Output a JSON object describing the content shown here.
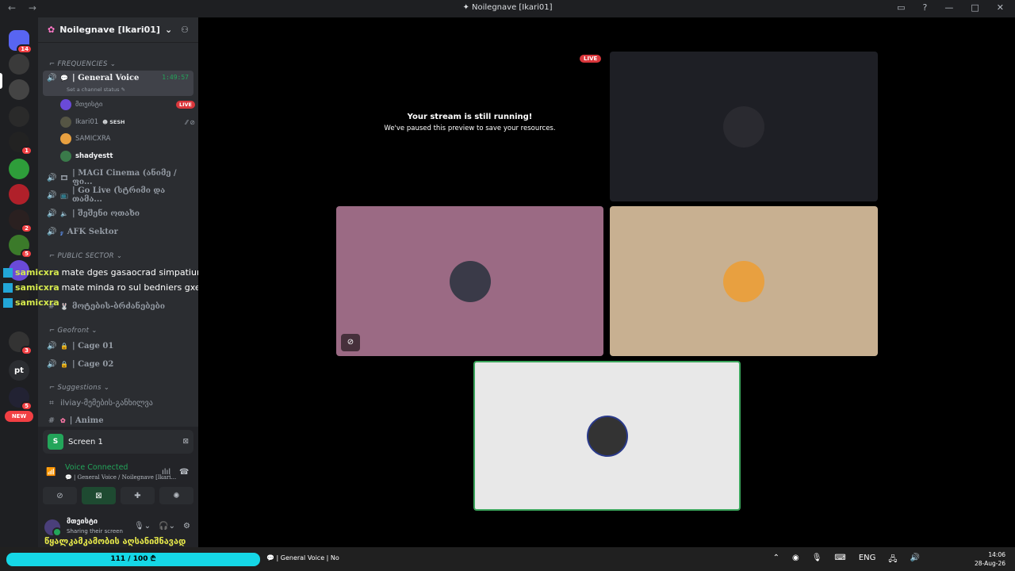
{
  "window": {
    "title": "Noilegnave [Ikari01]",
    "nav": "← →"
  },
  "guilds": {
    "items": [
      {
        "label": "",
        "badge": "14",
        "color": "#5865f2"
      },
      {
        "label": "",
        "badge": "",
        "color": "#3a3a3a"
      },
      {
        "label": "",
        "badge": "",
        "color": "#444"
      },
      {
        "label": "",
        "badge": "",
        "color": "#2a2a2a"
      },
      {
        "label": "",
        "badge": "1",
        "color": "#222"
      },
      {
        "label": "",
        "badge": "",
        "color": "#2e9d3a"
      },
      {
        "label": "",
        "badge": "",
        "color": "#b0202a"
      },
      {
        "label": "",
        "badge": "2",
        "color": "#2a2020"
      },
      {
        "label": "",
        "badge": "5",
        "color": "#3b7a2a"
      },
      {
        "label": "",
        "badge": "",
        "color": "#6a4ad8"
      },
      {
        "label": "",
        "badge": "",
        "color": "#222"
      },
      {
        "label": "",
        "badge": "3",
        "color": "#333"
      },
      {
        "label": "pt",
        "badge": "",
        "color": "#2b2d31"
      },
      {
        "label": "",
        "badge": "5",
        "color": "#223"
      }
    ],
    "new_pill": "NEW"
  },
  "server": {
    "name": "Noilegnave [Ikari01]"
  },
  "categories": {
    "frequencies": "FREQUENCIES",
    "public_sector": "PUBLIC SECTOR",
    "geofront": "Geofront",
    "suggestions": "Suggestions"
  },
  "channels": {
    "general_voice": {
      "name": "| General Voice",
      "timer": "1:49:57",
      "status": "Set a channel status"
    },
    "magi_cinema": "| MAGI Cinema (ანიმე / ფი...",
    "go_live": "| Go Live (სტრიმი და თამა...",
    "shemtsveni": "| შეშენი ოთახი",
    "afk": "AFK Sektor",
    "motebis": "მოტების-ბრძანებები",
    "cage01": "| Cage 01",
    "cage02": "| Cage 02",
    "ilviay": "ilviay-მემების-განხილვა",
    "anime": "| Anime"
  },
  "voice_users": [
    {
      "name": "მთეისტი",
      "badge": "LIVE",
      "color": "#6a4ad8"
    },
    {
      "name": "Ikari01",
      "tag": "SESH",
      "color": "#554"
    },
    {
      "name": "SAMICXRA",
      "color": "#e8a040"
    },
    {
      "name": "shadyestt",
      "color": "#3a7a4a"
    }
  ],
  "overlay_chat": [
    {
      "nick": "samicxra",
      "msg": "mate dges gasaocrad simpatiuri xar"
    },
    {
      "nick": "samicxra",
      "msg": "mate minda ro sul bedniers gxedavde sul tbilad"
    },
    {
      "nick": "samicxra",
      "msg": ""
    }
  ],
  "panel": {
    "screen_label": "Screen 1",
    "voice_connected": "Voice Connected",
    "voice_channel": "| General Voice / Noilegnave [Ikari...",
    "user_name": "მთეისტი",
    "user_status": "Sharing their screen"
  },
  "stream": {
    "title": "Your stream is still running!",
    "subtitle": "We've paused this preview to save your resources.",
    "live": "LIVE"
  },
  "tiles": {
    "top_right_color": "#1e1f25",
    "pink_color": "#9b6a84",
    "tan_color": "#c8b091",
    "white_color": "#e8e8e8"
  },
  "overlay_bottom": "წყალკამკამობის აღსანიშნავად",
  "taskbar": {
    "health": "111 / 100",
    "channel": "| General Voice | No",
    "lang": "ENG",
    "time": "14:06",
    "date": "28-Aug-26"
  }
}
